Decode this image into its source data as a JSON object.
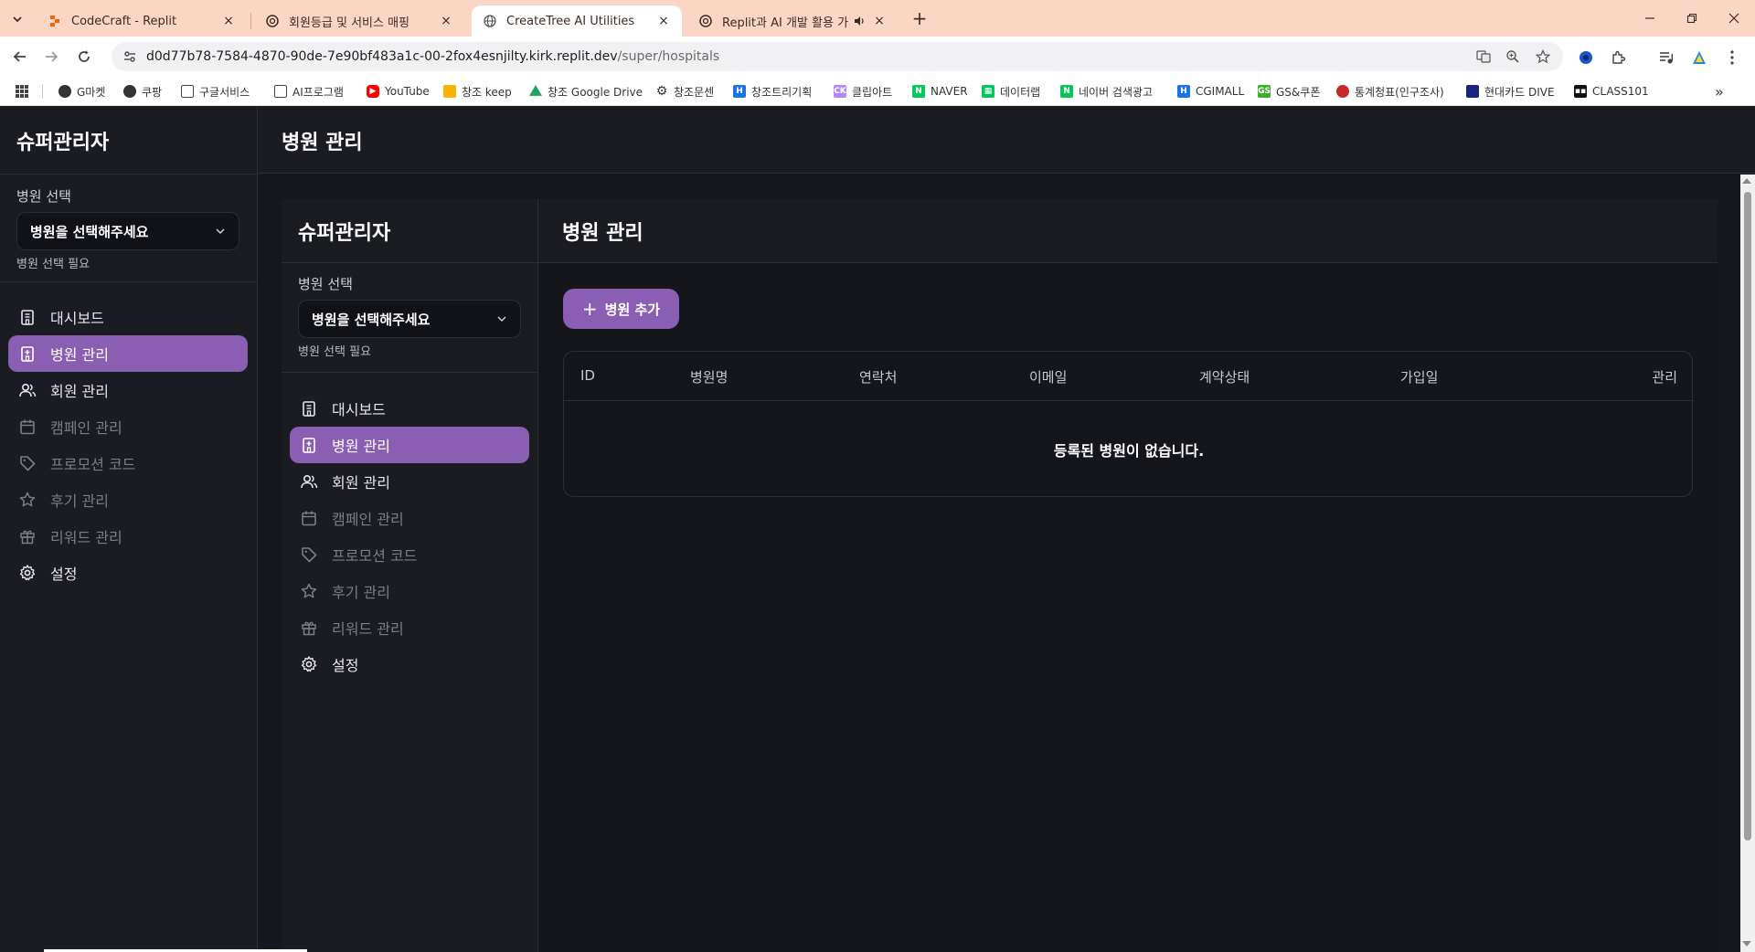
{
  "browser": {
    "tabs": [
      {
        "title": "CodeCraft - Replit",
        "close": "×"
      },
      {
        "title": "회원등급 및 서비스 매핑",
        "close": "×"
      },
      {
        "title": "CreateTree AI Utilities",
        "close": "×"
      },
      {
        "title": "Replit과 AI 개발 활용 가이",
        "close": "×"
      }
    ],
    "new_tab": "+",
    "url_host": "d0d77b78-7584-4870-90de-7e90bf483a1c-00-2fox4esnjilty.kirk.replit.dev",
    "url_path": "/super/hospitals",
    "bookmarks": [
      {
        "label": "G마켓",
        "color": "#333333"
      },
      {
        "label": "쿠팡",
        "color": "#333333"
      },
      {
        "label": "구글서비스",
        "color": "#333333"
      },
      {
        "label": "AI프로그램",
        "color": "#333333"
      },
      {
        "label": "YouTube",
        "color": "#ff0000"
      },
      {
        "label": "창조 keep",
        "color": "#f6b400"
      },
      {
        "label": "창조 Google Drive",
        "color": "#1fa463"
      },
      {
        "label": "창조문센",
        "color": "#333333"
      },
      {
        "label": "창조트리기획",
        "color": "#1a73e8"
      },
      {
        "label": "클립아트",
        "color": "#b388ff"
      },
      {
        "label": "NAVER",
        "color": "#03c75a"
      },
      {
        "label": "데이터랩",
        "color": "#03c75a"
      },
      {
        "label": "네이버 검색광고",
        "color": "#03c75a"
      },
      {
        "label": "CGIMALL",
        "color": "#1a73e8"
      },
      {
        "label": "GS&쿠폰",
        "color": "#3dae2b"
      },
      {
        "label": "통계청표(인구조사)",
        "color": "#c62828"
      },
      {
        "label": "현대카드 DIVE",
        "color": "#1a237e"
      },
      {
        "label": "CLASS101",
        "color": "#111111"
      }
    ],
    "more": "»"
  },
  "outer": {
    "brand": "슈퍼관리자",
    "page_title": "병원 관리",
    "select_label": "병원 선택",
    "select_value": "병원을 선택해주세요",
    "select_hint": "병원 선택 필요"
  },
  "inner": {
    "brand": "슈퍼관리자",
    "page_title": "병원 관리",
    "select_label": "병원 선택",
    "select_value": "병원을 선택해주세요",
    "select_hint": "병원 선택 필요",
    "add_button": "병원 추가",
    "columns": [
      "ID",
      "병원명",
      "연락처",
      "이메일",
      "계약상태",
      "가입일",
      "관리"
    ],
    "empty_message": "등록된 병원이 없습니다."
  },
  "nav": [
    {
      "label": "대시보드",
      "icon": "building-icon"
    },
    {
      "label": "병원 관리",
      "icon": "hospital-icon"
    },
    {
      "label": "회원 관리",
      "icon": "users-icon"
    },
    {
      "label": "캠페인 관리",
      "icon": "calendar-icon"
    },
    {
      "label": "프로모션 코드",
      "icon": "tag-icon"
    },
    {
      "label": "후기 관리",
      "icon": "star-icon"
    },
    {
      "label": "리워드 관리",
      "icon": "gift-icon"
    },
    {
      "label": "설정",
      "icon": "gear-icon"
    }
  ],
  "colors": {
    "accent": "#8a5fb3",
    "background": "#17181e",
    "tabbar": "#fcd6c4"
  }
}
